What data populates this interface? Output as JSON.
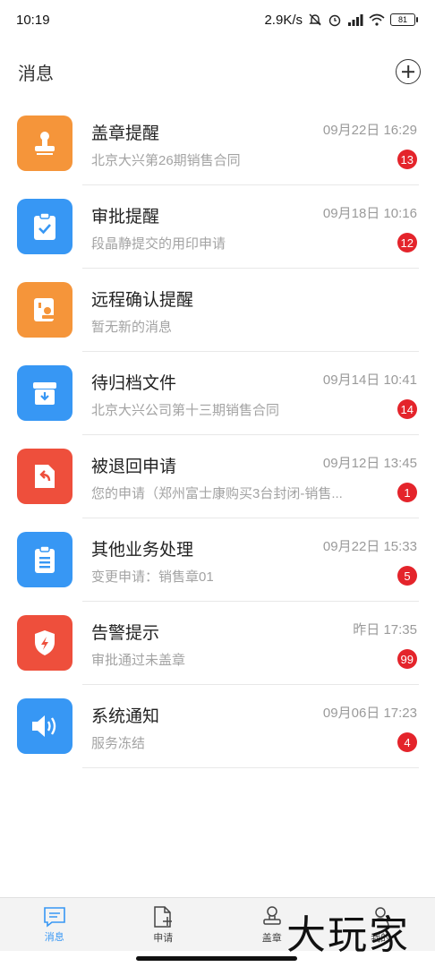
{
  "status": {
    "time": "10:19",
    "speed": "2.9K/s",
    "battery": "81"
  },
  "header": {
    "title": "消息"
  },
  "items": [
    {
      "name": "盖章提醒",
      "time": "09月22日 16:29",
      "sub": "北京大兴第26期销售合同",
      "badge": "13",
      "color": "orange",
      "icon": "stamp-icon"
    },
    {
      "name": "审批提醒",
      "time": "09月18日 10:16",
      "sub": "段晶静提交的用印申请",
      "badge": "12",
      "color": "blue",
      "icon": "clipboard-check-icon"
    },
    {
      "name": "远程确认提醒",
      "time": "",
      "sub": "暂无新的消息",
      "badge": "",
      "color": "orange",
      "icon": "remote-stamp-icon"
    },
    {
      "name": "待归档文件",
      "time": "09月14日 10:41",
      "sub": "北京大兴公司第十三期销售合同",
      "badge": "14",
      "color": "blue",
      "icon": "archive-box-icon"
    },
    {
      "name": "被退回申请",
      "time": "09月12日 13:45",
      "sub": "您的申请（郑州富士康购买3台封闭-销售...",
      "badge": "1",
      "color": "red",
      "icon": "return-document-icon"
    },
    {
      "name": "其他业务处理",
      "time": "09月22日 15:33",
      "sub": "变更申请：销售章01",
      "badge": "5",
      "color": "blue",
      "icon": "clipboard-list-icon"
    },
    {
      "name": "告警提示",
      "time": "昨日 17:35",
      "sub": "审批通过未盖章",
      "badge": "99",
      "color": "red",
      "icon": "shield-alert-icon"
    },
    {
      "name": "系统通知",
      "time": "09月06日 17:23",
      "sub": "服务冻结",
      "badge": "4",
      "color": "blue",
      "icon": "speaker-icon"
    }
  ],
  "tabs": [
    {
      "label": "消息",
      "icon": "message-icon",
      "active": true
    },
    {
      "label": "申请",
      "icon": "new-document-icon",
      "active": false
    },
    {
      "label": "盖章",
      "icon": "stamp-outline-icon",
      "active": false
    },
    {
      "label": "我的",
      "icon": "user-icon",
      "active": false
    }
  ],
  "watermark": "大玩家",
  "colors": {
    "orange": "#f5953a",
    "blue": "#3797f4",
    "red": "#ee4f3c",
    "badge": "#e4242b"
  }
}
